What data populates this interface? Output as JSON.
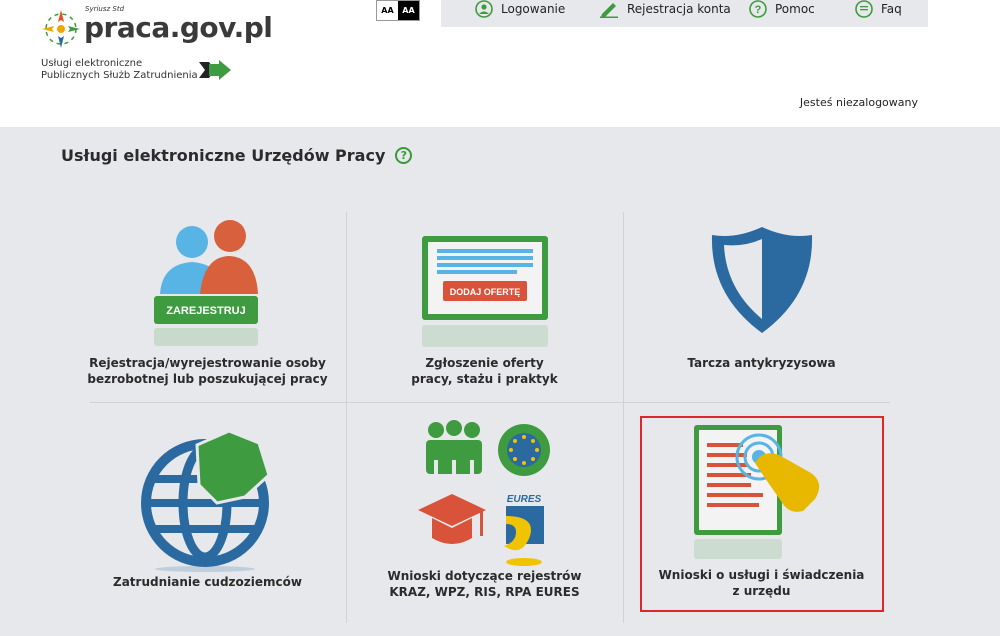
{
  "logo": {
    "superscript": "Syriusz Std",
    "site": "praca.gov.pl",
    "tagline_line1": "Usługi elektroniczne",
    "tagline_line2": "Publicznych Służb Zatrudnienia"
  },
  "contrast": {
    "normal": "AA",
    "high": "AA"
  },
  "nav": {
    "login": "Logowanie",
    "register": "Rejestracja konta",
    "help": "Pomoc",
    "faq": "Faq"
  },
  "status": "Jesteś niezalogowany",
  "section": {
    "title": "Usługi elektroniczne Urzędów Pracy",
    "help_symbol": "?"
  },
  "tiles": [
    {
      "line1": "Rejestracja/wyrejestrowanie osoby",
      "line2": "bezrobotnej lub poszukującej pracy",
      "badge": "ZAREJESTRUJ"
    },
    {
      "line1": "Zgłoszenie oferty",
      "line2": "pracy, stażu i praktyk",
      "badge": "DODAJ OFERTĘ"
    },
    {
      "line1": "Tarcza antykryzysowa",
      "line2": ""
    },
    {
      "line1": "Zatrudnianie cudzoziemców",
      "line2": ""
    },
    {
      "line1": "Wnioski dotyczące rejestrów",
      "line2": "KRAZ, WPZ, RIS, RPA EURES",
      "badge": "EURES"
    },
    {
      "line1": "Wnioski o usługi i świadczenia",
      "line2": "z urzędu"
    }
  ],
  "colors": {
    "green": "#3f9b3f",
    "blue": "#2a6aa0",
    "red": "#d9533a",
    "yellow": "#e8b800",
    "highlight": "#e0262b"
  }
}
